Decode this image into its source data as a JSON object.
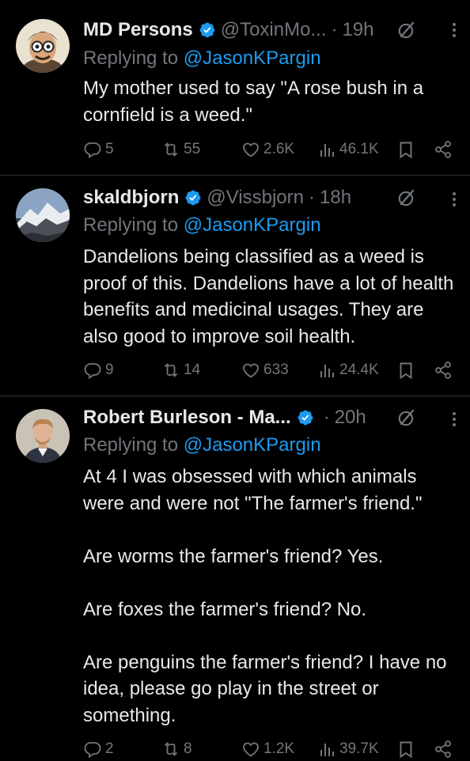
{
  "tweets": [
    {
      "name": "MD Persons",
      "handle": "@ToxinMo...",
      "time": "19h",
      "reply_prefix": "Replying to ",
      "reply_to": "@JasonKPargin",
      "text": "My mother used to say \"A rose bush in a cornfield is a weed.\"",
      "replies": "5",
      "reposts": "55",
      "likes": "2.6K",
      "views": "46.1K",
      "avatar": "cartoon-character-avatar"
    },
    {
      "name": "skaldbjorn",
      "handle": "@Vissbjorn",
      "time": "18h",
      "reply_prefix": "Replying to ",
      "reply_to": "@JasonKPargin",
      "text": "Dandelions being classified as a weed is proof of this. Dandelions have a lot of health benefits and medicinal usages. They are also good to improve soil health.",
      "replies": "9",
      "reposts": "14",
      "likes": "633",
      "views": "24.4K",
      "avatar": "mountain-landscape-avatar"
    },
    {
      "name": "Robert Burleson - Ma...",
      "handle": "",
      "time": "20h",
      "reply_prefix": "Replying to ",
      "reply_to": "@JasonKPargin",
      "text": "At 4 I was obsessed with which animals were and were not \"The farmer's friend.\"\n\nAre worms the farmer's friend? Yes.\n\nAre foxes the farmer's friend? No.\n\nAre penguins the farmer's friend? I have no idea, please go play in the street or something.",
      "replies": "2",
      "reposts": "8",
      "likes": "1.2K",
      "views": "39.7K",
      "avatar": "man-portrait-avatar"
    }
  ],
  "colors": {
    "background": "#000000",
    "text": "#e7e9ea",
    "muted": "#71767b",
    "accent": "#1d9bf0",
    "divider": "#2f3336"
  },
  "dot": "·"
}
